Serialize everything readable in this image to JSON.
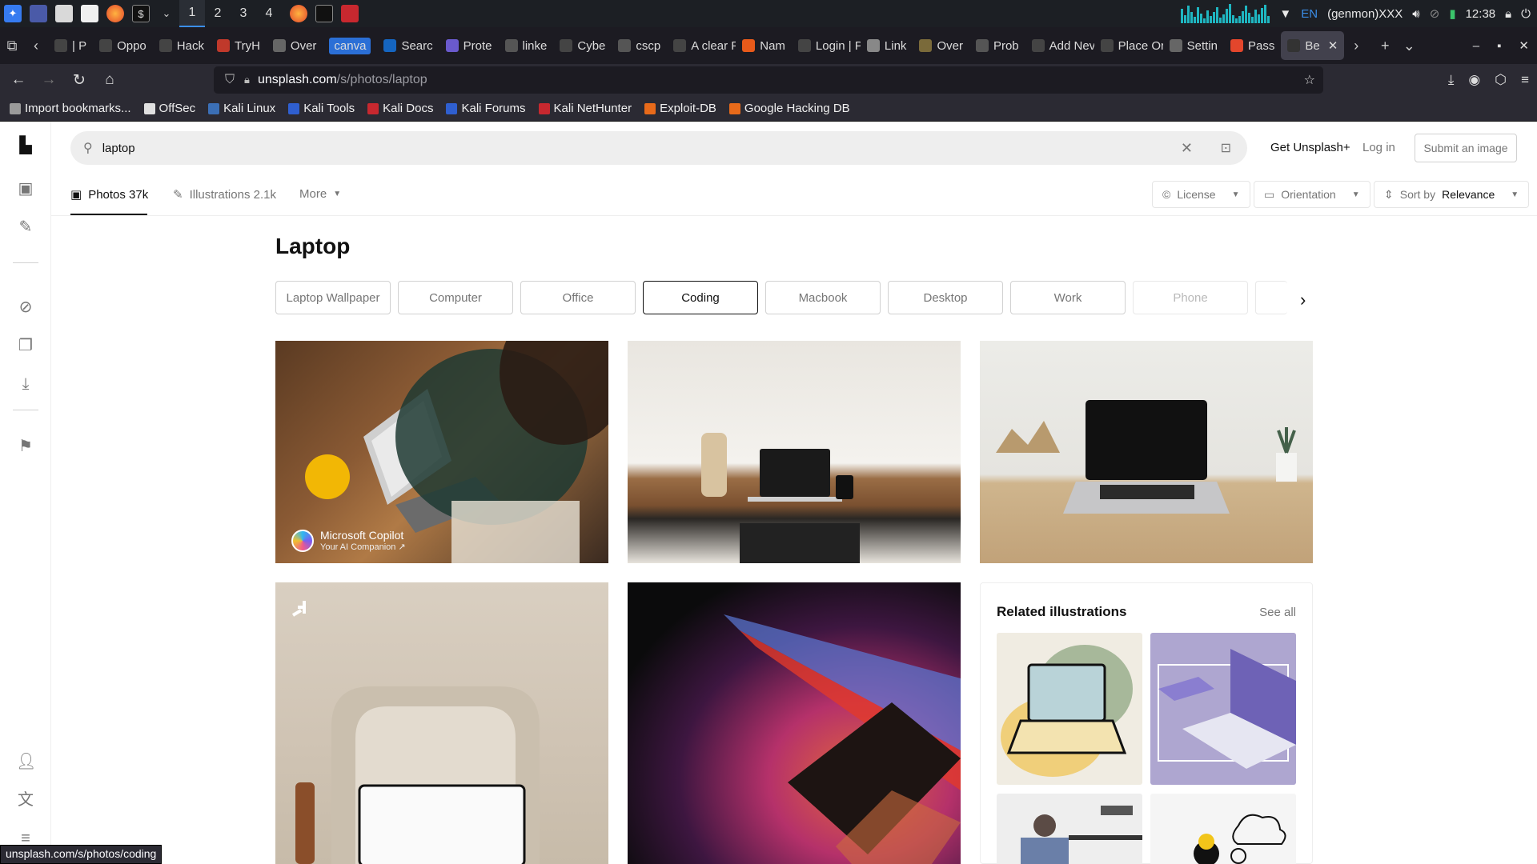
{
  "taskbar": {
    "workspaces": [
      "1",
      "2",
      "3",
      "4"
    ],
    "lang": "EN",
    "user": "(genmon)XXX",
    "clock": "12:38"
  },
  "tabs": [
    {
      "label": "| P"
    },
    {
      "label": "Oppo"
    },
    {
      "label": "Hack"
    },
    {
      "label": "TryH"
    },
    {
      "label": "Over"
    },
    {
      "label": "canva"
    },
    {
      "label": "Searc"
    },
    {
      "label": "Prote"
    },
    {
      "label": "linke"
    },
    {
      "label": "Cybe"
    },
    {
      "label": "cscp"
    },
    {
      "label": "A clear F"
    },
    {
      "label": "Nam"
    },
    {
      "label": "Login | P"
    },
    {
      "label": "Link"
    },
    {
      "label": "Over"
    },
    {
      "label": "Prob"
    },
    {
      "label": "Add Nev"
    },
    {
      "label": "Place Or"
    },
    {
      "label": "Settin"
    },
    {
      "label": "Pass"
    },
    {
      "label": "Be"
    }
  ],
  "url": {
    "host": "unsplash.com",
    "path": "/s/photos/laptop"
  },
  "bookmarks": [
    "Import bookmarks...",
    "OffSec",
    "Kali Linux",
    "Kali Tools",
    "Kali Docs",
    "Kali Forums",
    "Kali NetHunter",
    "Exploit-DB",
    "Google Hacking DB"
  ],
  "search": {
    "value": "laptop"
  },
  "header": {
    "get_plus": "Get Unsplash+",
    "login": "Log in",
    "submit": "Submit an image"
  },
  "subnav": {
    "photos": "Photos 37k",
    "illustrations": "Illustrations 2.1k",
    "more": "More"
  },
  "filters": {
    "license": "License",
    "orientation": "Orientation",
    "sort_prefix": "Sort by",
    "sort_value": "Relevance"
  },
  "page_title": "Laptop",
  "chips": [
    "Laptop Wallpaper",
    "Computer",
    "Office",
    "Coding",
    "Macbook",
    "Desktop",
    "Work",
    "Phone"
  ],
  "sponsor": {
    "name": "Microsoft Copilot",
    "tagline": "Your AI Companion ↗"
  },
  "related": {
    "title": "Related illustrations",
    "see_all": "See all"
  },
  "status_url": "unsplash.com/s/photos/coding"
}
